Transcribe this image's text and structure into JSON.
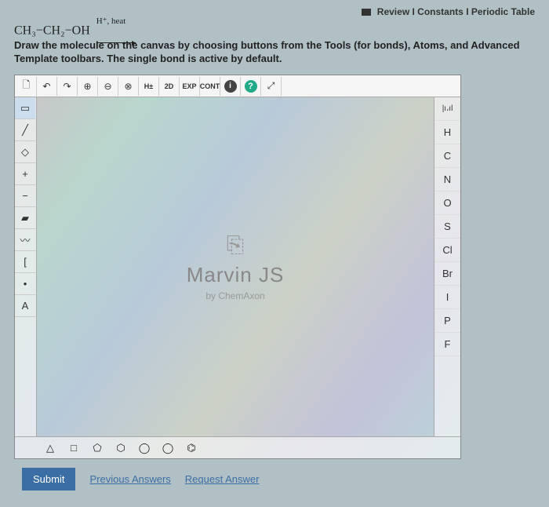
{
  "header": {
    "review": "Review",
    "constants": "Constants",
    "periodic": "Periodic Table"
  },
  "reaction": {
    "reactant": "CH₃−CH₂−OH",
    "condition": "H⁺, heat"
  },
  "instructions": "Draw the molecule on the canvas by choosing buttons from the Tools (for bonds), Atoms, and Advanced Template toolbars. The single bond is active by default.",
  "top_tools": {
    "new": "🗋",
    "undo": "↶",
    "redo": "↷",
    "zoom_in": "⊕",
    "zoom_out": "⊖",
    "delete": "⊗",
    "hydrogens": "H±",
    "view2d": "2D",
    "exp": "EXP",
    "cont": "CONT",
    "info": "i",
    "help": "?",
    "fullscreen": "⤢"
  },
  "left_tools": {
    "select": "▭",
    "single_bond": "╱",
    "eraser": "◇",
    "plus": "+",
    "minus": "−",
    "wedge": "▰",
    "wavy": "〰",
    "bracket": "[",
    "dot": "•",
    "atom_label": "A"
  },
  "atoms": [
    "H",
    "C",
    "N",
    "O",
    "S",
    "Cl",
    "Br",
    "I",
    "P",
    "F"
  ],
  "atom_top_icon": "|ı،ıl",
  "bottom_shapes": [
    "△",
    "□",
    "⬠",
    "⬡",
    "◯",
    "◯",
    "⌬"
  ],
  "brand": {
    "name": "Marvin JS",
    "by": "by ChemAxon",
    "icon": "⎘"
  },
  "footer": {
    "submit": "Submit",
    "prev": "Previous Answers",
    "request": "Request Answer"
  }
}
